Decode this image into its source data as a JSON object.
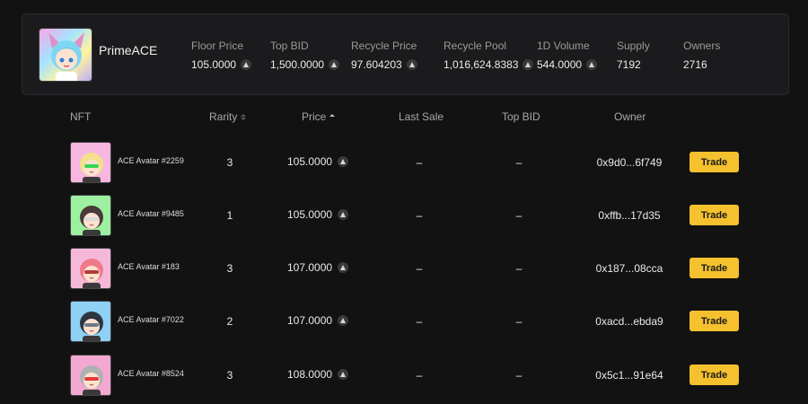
{
  "collection": {
    "name": "PrimeACE",
    "stats": [
      {
        "label": "Floor Price",
        "value": "105.0000",
        "coin": true
      },
      {
        "label": "Top BID",
        "value": "1,500.0000",
        "coin": true
      },
      {
        "label": "Recycle Price",
        "value": "97.604203",
        "coin": true
      },
      {
        "label": "Recycle Pool",
        "value": "1,016,624.8383",
        "coin": true
      },
      {
        "label": "1D Volume",
        "value": "544.0000",
        "coin": true
      },
      {
        "label": "Supply",
        "value": "7192",
        "coin": false
      },
      {
        "label": "Owners",
        "value": "2716",
        "coin": false
      }
    ]
  },
  "table": {
    "headers": {
      "nft": "NFT",
      "rarity": "Rarity",
      "price": "Price",
      "last_sale": "Last Sale",
      "top_bid": "Top BID",
      "owner": "Owner"
    },
    "rows": [
      {
        "name": "ACE Avatar #2259",
        "rarity": "3",
        "price": "105.0000",
        "last_sale": "–",
        "top_bid": "–",
        "owner": "0x9d0...6f749",
        "action": "Trade",
        "bg": "#f7b6e0",
        "hair": "#f3e08a",
        "accent": "#39d353"
      },
      {
        "name": "ACE Avatar #9485",
        "rarity": "1",
        "price": "105.0000",
        "last_sale": "–",
        "top_bid": "–",
        "owner": "0xffb...17d35",
        "action": "Trade",
        "bg": "#9df0a0",
        "hair": "#4a3a3a",
        "accent": "#d9d9d9"
      },
      {
        "name": "ACE Avatar #183",
        "rarity": "3",
        "price": "107.0000",
        "last_sale": "–",
        "top_bid": "–",
        "owner": "0x187...08cca",
        "action": "Trade",
        "bg": "#f6b8d9",
        "hair": "#f07a8a",
        "accent": "#b33a3a"
      },
      {
        "name": "ACE Avatar #7022",
        "rarity": "2",
        "price": "107.0000",
        "last_sale": "–",
        "top_bid": "–",
        "owner": "0xacd...ebda9",
        "action": "Trade",
        "bg": "#8fd0f5",
        "hair": "#2e3440",
        "accent": "#6b7a88"
      },
      {
        "name": "ACE Avatar #8524",
        "rarity": "3",
        "price": "108.0000",
        "last_sale": "–",
        "top_bid": "–",
        "owner": "0x5c1...91e64",
        "action": "Trade",
        "bg": "#f3a8d2",
        "hair": "#b0b0b0",
        "accent": "#e23a3a"
      }
    ]
  },
  "colors": {
    "background": "#121212",
    "card": "#1b1b1d",
    "accent_button": "#f5c12e"
  }
}
